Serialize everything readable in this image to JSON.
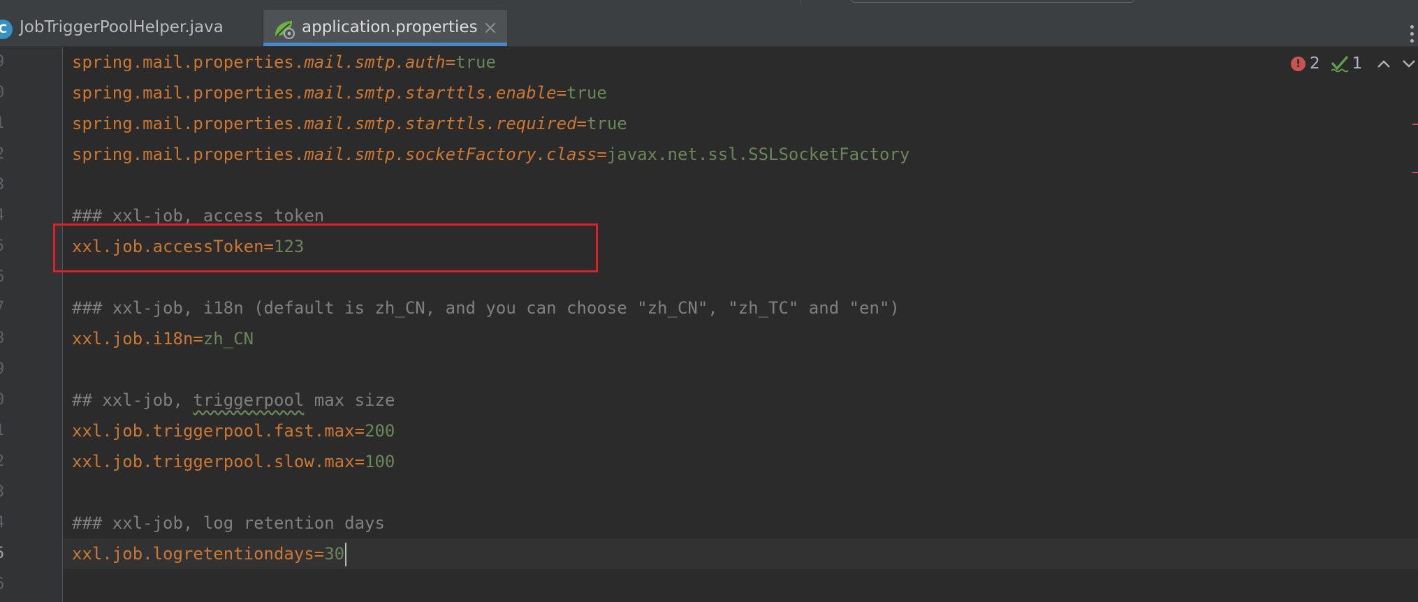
{
  "tabs": [
    {
      "label": "JobTriggerPoolHelper.java",
      "icon": "java-class-icon",
      "icon_text": "C",
      "active": false
    },
    {
      "label": "application.properties",
      "icon": "spring-leaf-icon",
      "active": true,
      "close_icon": "close-icon",
      "close_glyph": "×"
    }
  ],
  "inspections": {
    "errors": "2",
    "warnings": "1"
  },
  "lines": [
    {
      "num": "9",
      "text": "spring.mail.properties.mail.smtp.auth=true"
    },
    {
      "num": "0",
      "text": "spring.mail.properties.mail.smtp.starttls.enable=true"
    },
    {
      "num": "1",
      "text": "spring.mail.properties.mail.smtp.starttls.required=true"
    },
    {
      "num": "2",
      "text": "spring.mail.properties.mail.smtp.socketFactory.class=javax.net.ssl.SSLSocketFactory"
    },
    {
      "num": "3",
      "text": ""
    },
    {
      "num": "4",
      "text": "### xxl-job, access token"
    },
    {
      "num": "5",
      "text": "xxl.job.accessToken=123"
    },
    {
      "num": "6",
      "text": ""
    },
    {
      "num": "7",
      "text": "### xxl-job, i18n (default is zh_CN, and you can choose \"zh_CN\", \"zh_TC\" and \"en\")"
    },
    {
      "num": "8",
      "text": "xxl.job.i18n=zh_CN"
    },
    {
      "num": "9",
      "text": ""
    },
    {
      "num": "0",
      "text": "## xxl-job, triggerpool max size"
    },
    {
      "num": "1",
      "text": "xxl.job.triggerpool.fast.max=200"
    },
    {
      "num": "2",
      "text": "xxl.job.triggerpool.slow.max=100"
    },
    {
      "num": "3",
      "text": ""
    },
    {
      "num": "4",
      "text": "### xxl-job, log retention days"
    },
    {
      "num": "5",
      "text": "xxl.job.logretentiondays=30"
    },
    {
      "num": "6",
      "text": ""
    }
  ],
  "code": {
    "l0": {
      "a": "spring.mail.properties.",
      "b": "mail.smtp.auth",
      "eq": "=",
      "v": "true"
    },
    "l1": {
      "a": "spring.mail.properties.",
      "b": "mail.smtp.starttls.enable",
      "eq": "=",
      "v": "true"
    },
    "l2": {
      "a": "spring.mail.properties.",
      "b": "mail.smtp.starttls.required",
      "eq": "=",
      "v": "true"
    },
    "l3": {
      "a": "spring.mail.properties.",
      "b": "mail.smtp.socketFactory.class",
      "eq": "=",
      "v": "javax.net.ssl.SSLSocketFactory"
    },
    "l5": {
      "c": "### xxl-job, access token"
    },
    "l6": {
      "a": "xxl.job.accessToken",
      "eq": "=",
      "v": "123"
    },
    "l8": {
      "c": "### xxl-job, i18n (default is zh_CN, and you can choose \"zh_CN\", \"zh_TC\" and \"en\")"
    },
    "l9": {
      "a": "xxl.job.i18n",
      "eq": "=",
      "v": "zh_CN"
    },
    "l11": {
      "c1": "## xxl-job, ",
      "typo": "triggerpool",
      "c2": " max size"
    },
    "l12": {
      "a": "xxl.job.triggerpool.fast.max",
      "eq": "=",
      "v": "200"
    },
    "l13": {
      "a": "xxl.job.triggerpool.slow.max",
      "eq": "=",
      "v": "100"
    },
    "l15": {
      "c": "### xxl-job, log retention days"
    },
    "l16": {
      "a": "xxl.job.logretentiondays",
      "eq": "=",
      "v": "30"
    }
  },
  "colors": {
    "key": "#cc7832",
    "value": "#6a8759",
    "comment": "#808080",
    "highlight": "#e31e2b",
    "active_tab_underline": "#4a88c7"
  }
}
